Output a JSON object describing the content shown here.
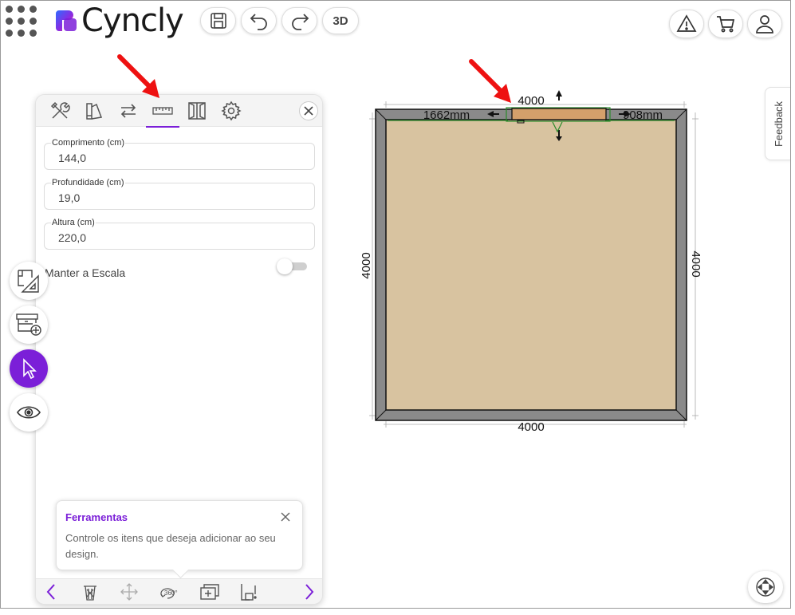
{
  "app": {
    "brand": "Cyncly",
    "brand_color": "#7b1fd8"
  },
  "toolbar": {
    "icons": [
      "apps-grid-icon",
      "save-icon",
      "undo-icon",
      "redo-icon"
    ],
    "view_3d_label": "3D",
    "right_icons": [
      "warning-icon",
      "cart-icon",
      "user-icon"
    ]
  },
  "feedback": {
    "label": "Feedback"
  },
  "side_buttons": [
    {
      "icon": "floorplan-icon",
      "active": false
    },
    {
      "icon": "add-cabinet-icon",
      "active": false
    },
    {
      "icon": "pointer-icon",
      "active": true
    },
    {
      "icon": "eye-icon",
      "active": false
    }
  ],
  "panel": {
    "tabs": [
      "tools-icon",
      "color-palette-icon",
      "swap-icon",
      "ruler-icon",
      "door-icon",
      "gear-icon"
    ],
    "active_tab": "ruler-icon",
    "fields": [
      {
        "label": "Comprimento (cm)",
        "value": "144,0"
      },
      {
        "label": "Profundidade (cm)",
        "value": "19,0"
      },
      {
        "label": "Altura (cm)",
        "value": "220,0"
      }
    ],
    "scale_label": "Manter a Escala",
    "scale_enabled": false,
    "tooltip": {
      "title": "Ferramentas",
      "body": "Controle os itens que deseja adicionar ao seu design."
    },
    "bottom_icons": [
      "prev-icon",
      "trash-icon",
      "move-icon",
      "rotate-360-icon",
      "duplicate-icon",
      "align-icon",
      "next-icon"
    ]
  },
  "plan": {
    "top_dim": "4000",
    "bottom_dim": "4000",
    "left_dim": "4000",
    "right_dim": "4000",
    "left_offset": "1662mm",
    "right_offset": "908mm",
    "floor_color": "#d8c3a0",
    "wall_color": "#8a8a8a",
    "item_color": "#d4a06b"
  }
}
